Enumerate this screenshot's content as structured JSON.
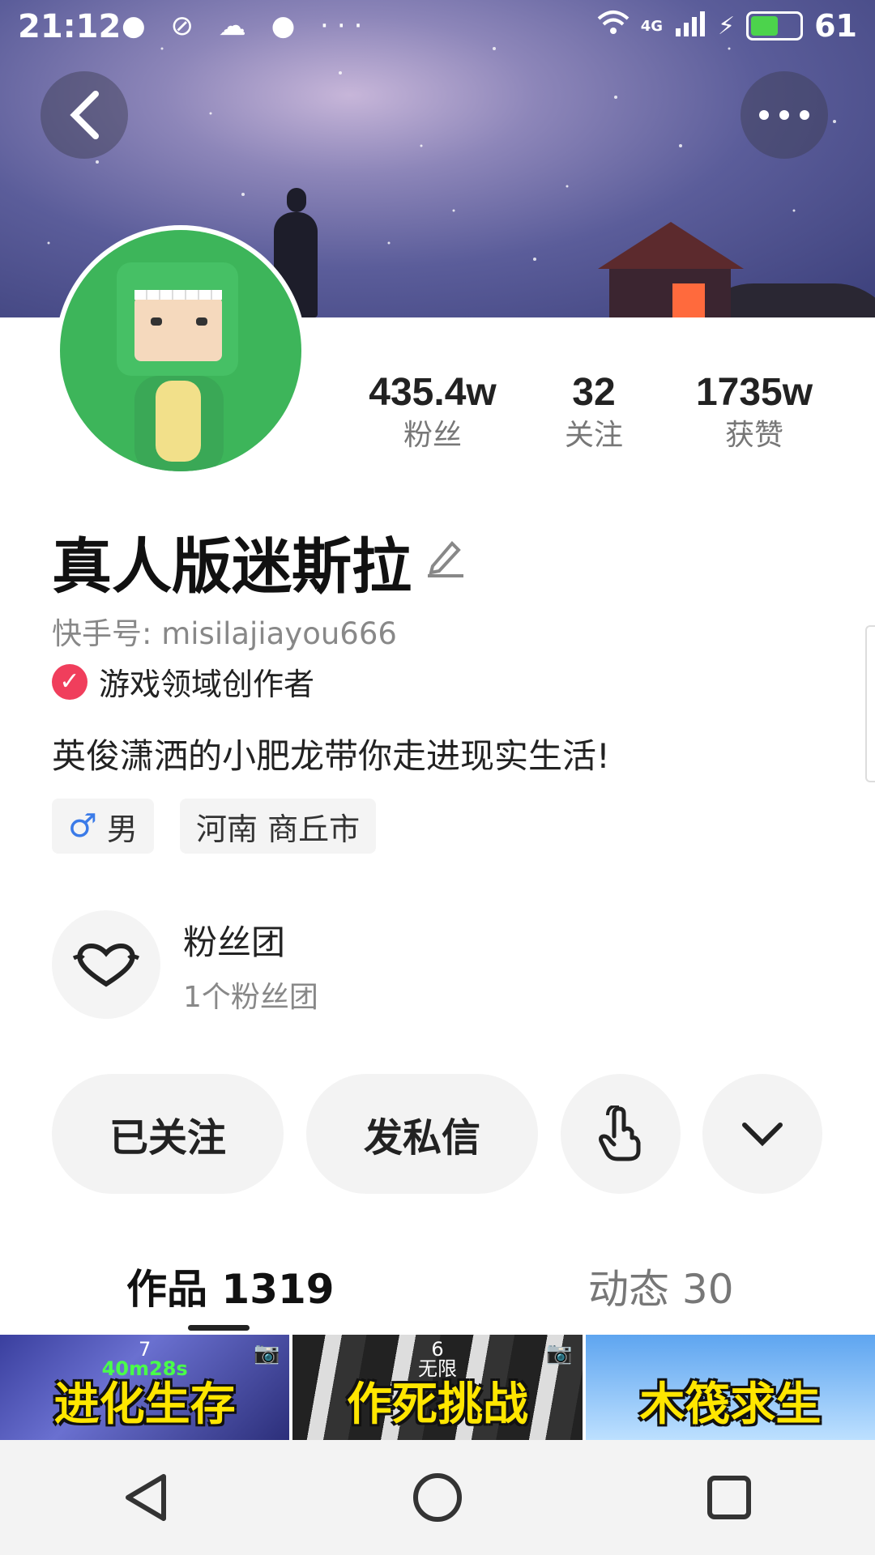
{
  "status_bar": {
    "time": "21:12",
    "left_icons": "● ⊘ ☁ ● ···",
    "network": "4G",
    "battery": "61",
    "battery_level": 0.61,
    "battery_color": "#4cd34c"
  },
  "header": {
    "back_icon": "chevron-left-icon",
    "more_icon": "more-horizontal-icon"
  },
  "profile": {
    "stats": [
      {
        "value": "435.4w",
        "label": "粉丝"
      },
      {
        "value": "32",
        "label": "关注"
      },
      {
        "value": "1735w",
        "label": "获赞"
      }
    ],
    "name": "真人版迷斯拉",
    "kwai_id": "快手号: misilajiayou666",
    "creator_badge": "游戏领域创作者",
    "bio": "英俊潇洒的小肥龙带你走进现实生活!",
    "tags": {
      "gender": "男",
      "location": "河南 商丘市"
    }
  },
  "fan_club": {
    "title": "粉丝团",
    "subtitle": "1个粉丝团"
  },
  "actions": {
    "follow_label": "已关注",
    "message_label": "发私信"
  },
  "tabs": {
    "works": "作品 1319",
    "moments": "动态 30"
  },
  "thumbnails": [
    {
      "title": "进化生存",
      "badge_top": "7",
      "badge_sub": "40m28s"
    },
    {
      "title": "作死挑战",
      "badge_top": "6",
      "badge_sub": "无限"
    },
    {
      "title": "木筏求生",
      "badge_top": "",
      "badge_sub": ""
    }
  ],
  "colors": {
    "accent_red": "#f03e5c",
    "male_blue": "#3b7be8",
    "thumbnail_text": "#ffe600"
  }
}
